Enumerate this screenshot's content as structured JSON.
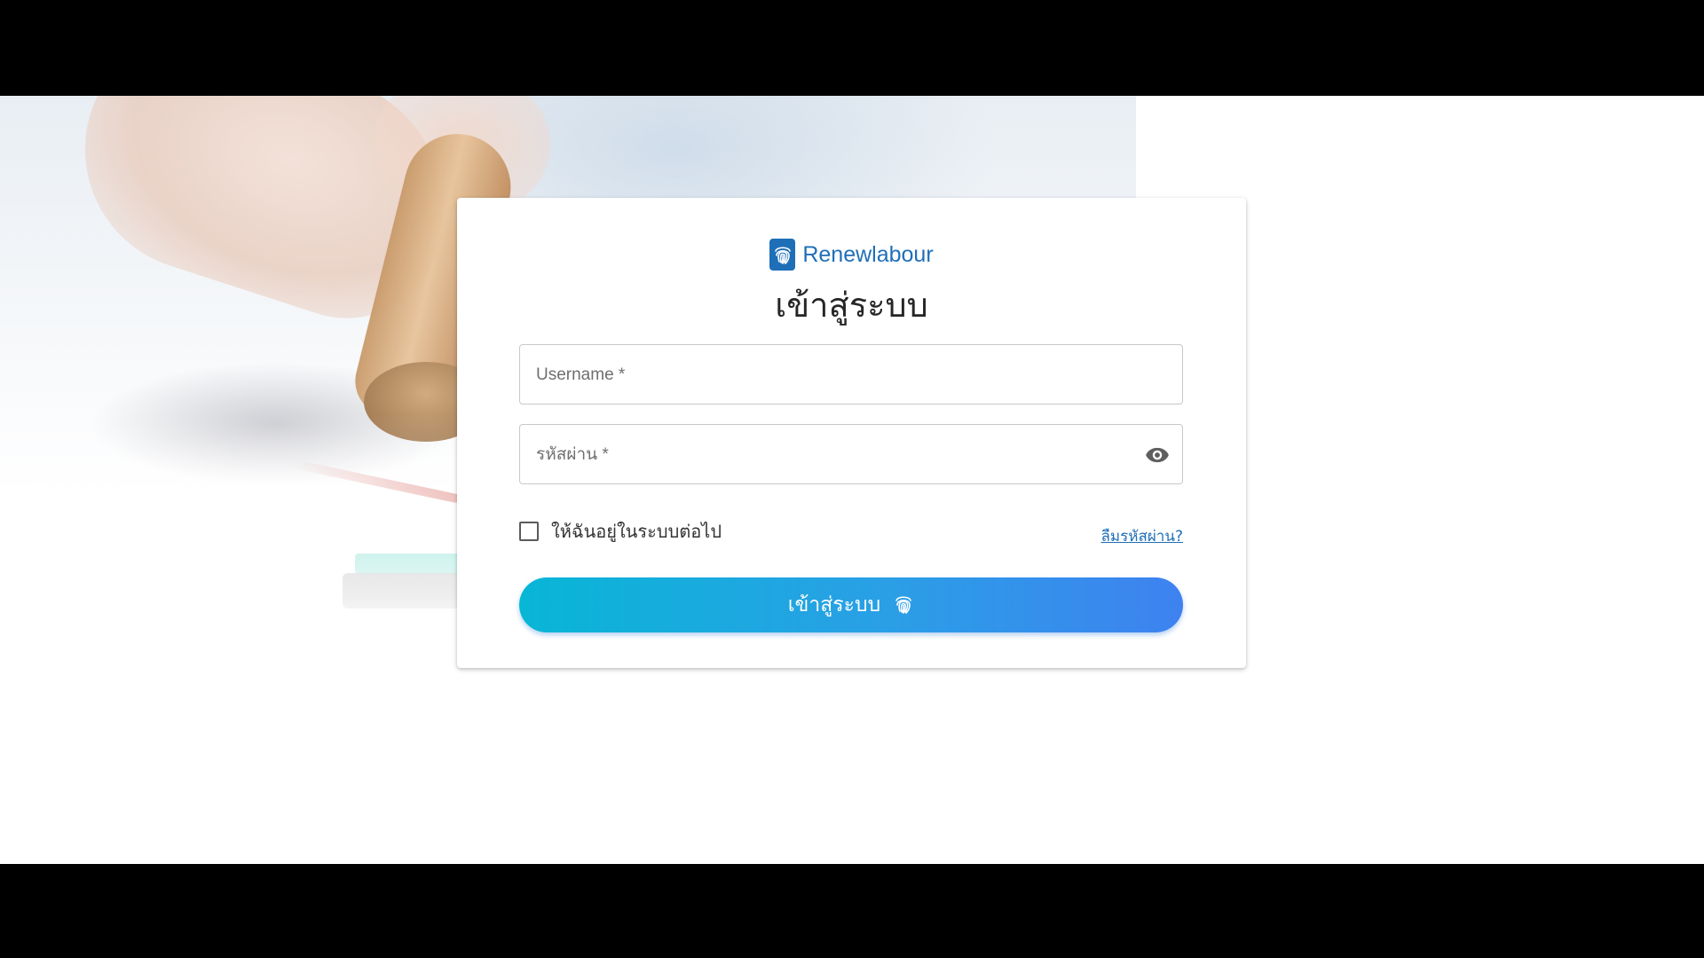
{
  "brand": {
    "name": "Renewlabour",
    "logo_icon": "fingerprint-icon",
    "color": "#1f6fb8"
  },
  "login": {
    "title": "เข้าสู่ระบบ",
    "username_placeholder": "Username *",
    "password_placeholder": "รหัสผ่าน *",
    "toggle_password_icon": "eye-icon",
    "remember_label": "ให้ฉันอยู่ในระบบต่อไป",
    "remember_checked": false,
    "forgot_link": "ลืมรหัสผ่าน?",
    "submit_label": "เข้าสู่ระบบ",
    "submit_icon": "fingerprint-icon",
    "submit_gradient": [
      "#08b6d6",
      "#3e82f0"
    ]
  }
}
